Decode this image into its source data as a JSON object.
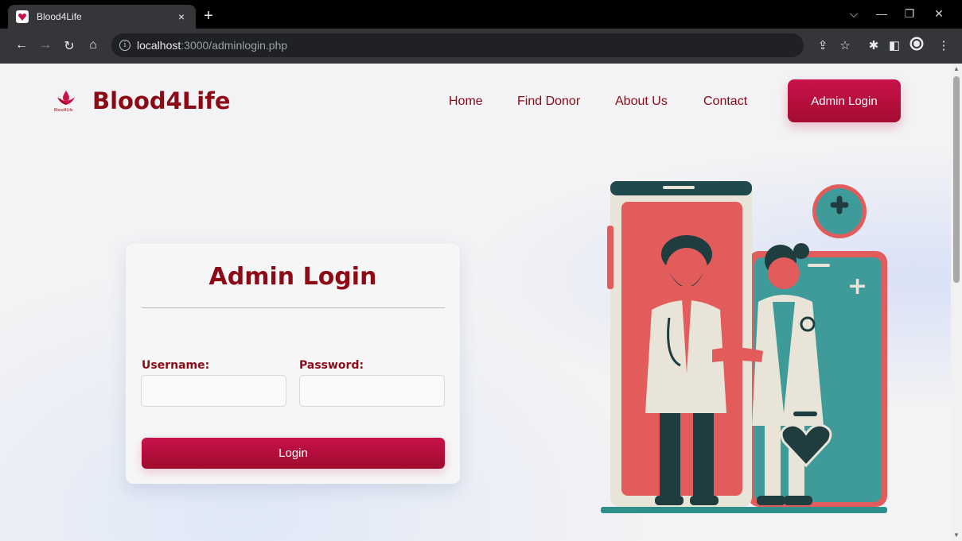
{
  "browser": {
    "tab_title": "Blood4Life",
    "tab_close": "×",
    "new_tab": "+",
    "url_host": "localhost",
    "url_path": ":3000/adminlogin.php",
    "window_controls": [
      "chevron-down-icon",
      "minimize-icon",
      "restore-icon",
      "close-icon"
    ],
    "nav_icons": [
      "back-arrow-icon",
      "forward-arrow-icon",
      "reload-icon",
      "home-icon"
    ],
    "toolbar_icons": [
      "share-icon",
      "star-icon",
      "extensions-icon",
      "sidepanel-icon",
      "profile-icon",
      "kebab-menu-icon"
    ]
  },
  "site": {
    "brand_name": "Blood4Life",
    "logo_caption": "Blood4Life",
    "nav": {
      "home": "Home",
      "find_donor": "Find Donor",
      "about_us": "About Us",
      "contact": "Contact"
    },
    "admin_button": "Admin Login"
  },
  "login_card": {
    "title": "Admin Login",
    "username_label": "Username:",
    "password_label": "Password:",
    "username_value": "",
    "password_value": "",
    "login_button": "Login"
  },
  "colors": {
    "brand": "#8b0a16",
    "button_gradient_top": "#c8124a",
    "button_gradient_bottom": "#a60c30"
  }
}
